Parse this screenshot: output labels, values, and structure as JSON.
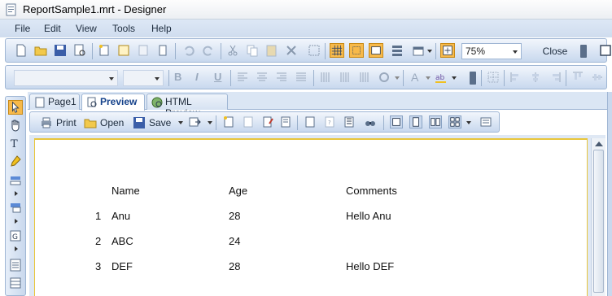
{
  "window": {
    "title": "ReportSample1.mrt - Designer"
  },
  "menu": {
    "items": [
      "File",
      "Edit",
      "View",
      "Tools",
      "Help"
    ]
  },
  "toolbar": {
    "zoom_value": "75%",
    "close_label": "Close"
  },
  "format_toolbar": {
    "bold": "B",
    "italic": "I",
    "underline": "U"
  },
  "tabs": [
    {
      "label": "Page1",
      "icon": "page-icon"
    },
    {
      "label": "Preview",
      "icon": "preview-icon",
      "active": true
    },
    {
      "label": "HTML Preview",
      "icon": "globe-icon"
    }
  ],
  "preview_toolbar": {
    "print": "Print",
    "open": "Open",
    "save": "Save"
  },
  "report": {
    "headers": [
      "Name",
      "Age",
      "Comments"
    ],
    "rows": [
      {
        "num": "1",
        "name": "Anu",
        "age": "28",
        "comments": "Hello Anu"
      },
      {
        "num": "2",
        "name": "ABC",
        "age": "24",
        "comments": ""
      },
      {
        "num": "3",
        "name": "DEF",
        "age": "28",
        "comments": "Hello DEF"
      }
    ]
  },
  "colors": {
    "accent": "#15428b",
    "page_border": "#e8c53a",
    "toolbar_bg": "#c8d8ee",
    "active_toggle": "#f7b94a"
  }
}
